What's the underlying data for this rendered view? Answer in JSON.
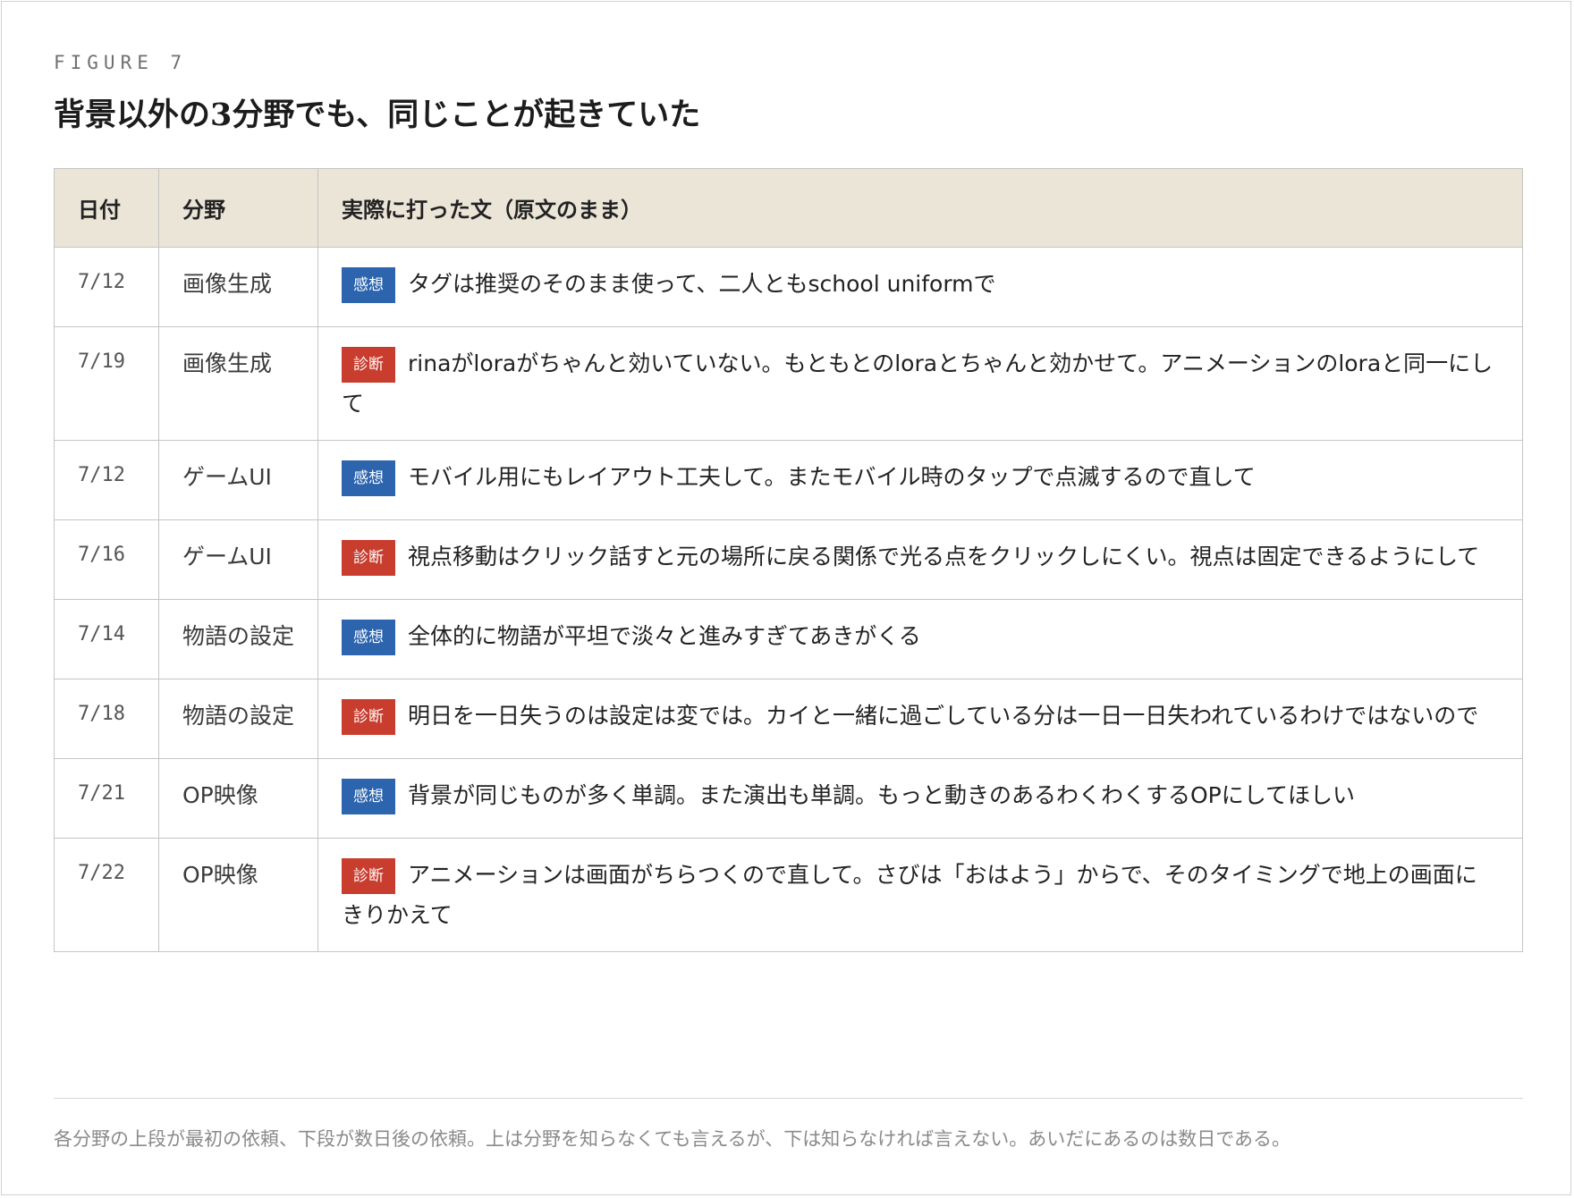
{
  "figure": {
    "label": "FIGURE 7",
    "title": "背景以外の3分野でも、同じことが起きていた"
  },
  "table": {
    "headers": [
      "日付",
      "分野",
      "実際に打った文（原文のまま）"
    ],
    "rows": [
      {
        "date": "7/12",
        "field": "画像生成",
        "badge": "感想",
        "badge_type": "impression",
        "text": "タグは推奨のそのまま使って、二人ともschool uniformで"
      },
      {
        "date": "7/19",
        "field": "画像生成",
        "badge": "診断",
        "badge_type": "diagnosis",
        "text": "rinaがloraがちゃんと効いていない。もともとのloraとちゃんと効かせて。アニメーションのloraと同一にして"
      },
      {
        "date": "7/12",
        "field": "ゲームUI",
        "badge": "感想",
        "badge_type": "impression",
        "text": "モバイル用にもレイアウト工夫して。またモバイル時のタップで点滅するので直して"
      },
      {
        "date": "7/16",
        "field": "ゲームUI",
        "badge": "診断",
        "badge_type": "diagnosis",
        "text": "視点移動はクリック話すと元の場所に戻る関係で光る点をクリックしにくい。視点は固定できるようにして"
      },
      {
        "date": "7/14",
        "field": "物語の設定",
        "badge": "感想",
        "badge_type": "impression",
        "text": "全体的に物語が平坦で淡々と進みすぎてあきがくる"
      },
      {
        "date": "7/18",
        "field": "物語の設定",
        "badge": "診断",
        "badge_type": "diagnosis",
        "text": "明日を一日失うのは設定は変では。カイと一緒に過ごしている分は一日一日失われているわけではないので"
      },
      {
        "date": "7/21",
        "field": "OP映像",
        "badge": "感想",
        "badge_type": "impression",
        "text": "背景が同じものが多く単調。また演出も単調。もっと動きのあるわくわくするOPにしてほしい"
      },
      {
        "date": "7/22",
        "field": "OP映像",
        "badge": "診断",
        "badge_type": "diagnosis",
        "text": "アニメーションは画面がちらつくので直して。さびは「おはよう」からで、そのタイミングで地上の画面にきりかえて"
      }
    ]
  },
  "colors": {
    "header_bg": "#ebe5d8",
    "impression_badge": "#2c64ae",
    "diagnosis_badge": "#c83d2e"
  },
  "caption": "各分野の上段が最初の依頼、下段が数日後の依頼。上は分野を知らなくても言えるが、下は知らなければ言えない。あいだにあるのは数日である。"
}
